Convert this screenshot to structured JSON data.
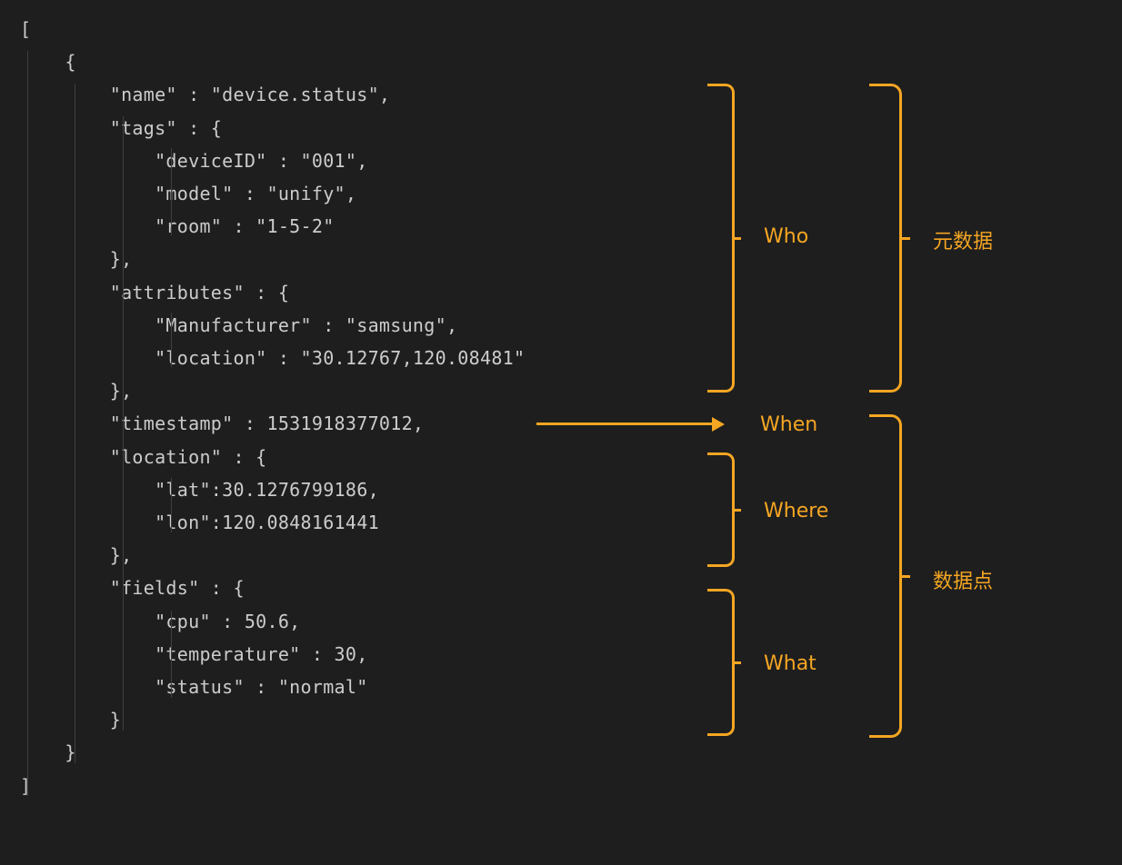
{
  "code": {
    "l1": "[",
    "l2": "    {",
    "l3": "        \"name\" : \"device.status\",",
    "l4": "        \"tags\" : {",
    "l5": "            \"deviceID\" : \"001\",",
    "l6": "            \"model\" : \"unify\",",
    "l7": "            \"room\" : \"1-5-2\"",
    "l8": "        },",
    "l9": "        \"attributes\" : {",
    "l10": "            \"Manufacturer\" : \"samsung\",",
    "l11": "            \"location\" : \"30.12767,120.08481\"",
    "l12": "        },",
    "l13": "        \"timestamp\" : 1531918377012,",
    "l14": "        \"location\" : {",
    "l15": "            \"lat\":30.1276799186,",
    "l16": "            \"lon\":120.0848161441",
    "l17": "        },",
    "l18": "        \"fields\" : {",
    "l19": "            \"cpu\" : 50.6,",
    "l20": "            \"temperature\" : 30,",
    "l21": "            \"status\" : \"normal\"",
    "l22": "        }",
    "l23": "    }",
    "l24": "]"
  },
  "annotations": {
    "who": "Who",
    "when": "When",
    "where": "Where",
    "what": "What",
    "metadata": "元数据",
    "datapoint": "数据点"
  }
}
